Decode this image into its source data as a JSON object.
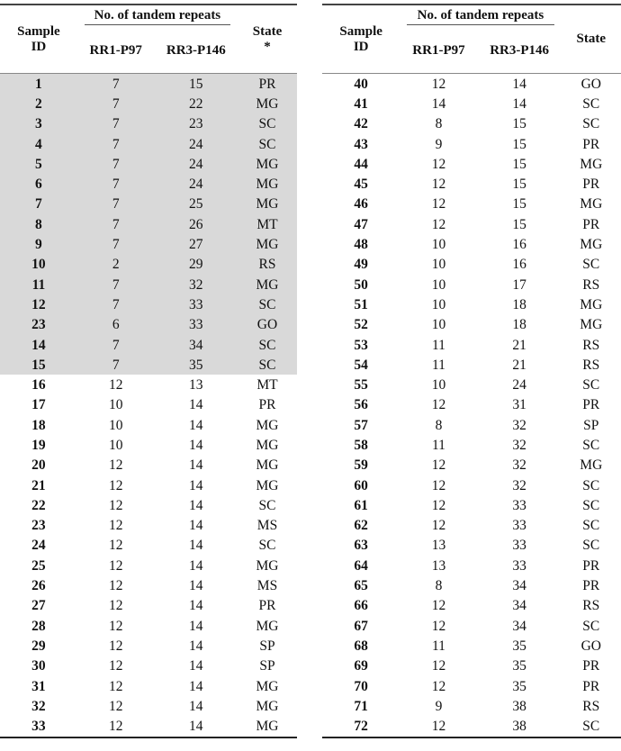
{
  "left_table": {
    "headers": {
      "sample_id": "Sample\nID",
      "sample_id_line1": "Sample",
      "sample_id_line2": "ID",
      "group": "No. of tandem repeats",
      "rr1": "RR1-P97",
      "rr3": "RR3-P146",
      "state_line1": "State",
      "state_line2": "*"
    },
    "rows": [
      {
        "id": "1",
        "rr1": "7",
        "rr3": "15",
        "state": "PR",
        "shaded": true
      },
      {
        "id": "2",
        "rr1": "7",
        "rr3": "22",
        "state": "MG",
        "shaded": true
      },
      {
        "id": "3",
        "rr1": "7",
        "rr3": "23",
        "state": "SC",
        "shaded": true
      },
      {
        "id": "4",
        "rr1": "7",
        "rr3": "24",
        "state": "SC",
        "shaded": true
      },
      {
        "id": "5",
        "rr1": "7",
        "rr3": "24",
        "state": "MG",
        "shaded": true
      },
      {
        "id": "6",
        "rr1": "7",
        "rr3": "24",
        "state": "MG",
        "shaded": true
      },
      {
        "id": "7",
        "rr1": "7",
        "rr3": "25",
        "state": "MG",
        "shaded": true
      },
      {
        "id": "8",
        "rr1": "7",
        "rr3": "26",
        "state": "MT",
        "shaded": true
      },
      {
        "id": "9",
        "rr1": "7",
        "rr3": "27",
        "state": "MG",
        "shaded": true
      },
      {
        "id": "10",
        "rr1": "2",
        "rr3": "29",
        "state": "RS",
        "shaded": true
      },
      {
        "id": "11",
        "rr1": "7",
        "rr3": "32",
        "state": "MG",
        "shaded": true
      },
      {
        "id": "12",
        "rr1": "7",
        "rr3": "33",
        "state": "SC",
        "shaded": true
      },
      {
        "id": "23",
        "rr1": "6",
        "rr3": "33",
        "state": "GO",
        "shaded": true
      },
      {
        "id": "14",
        "rr1": "7",
        "rr3": "34",
        "state": "SC",
        "shaded": true
      },
      {
        "id": "15",
        "rr1": "7",
        "rr3": "35",
        "state": "SC",
        "shaded": true
      },
      {
        "id": "16",
        "rr1": "12",
        "rr3": "13",
        "state": "MT",
        "shaded": false
      },
      {
        "id": "17",
        "rr1": "10",
        "rr3": "14",
        "state": "PR",
        "shaded": false
      },
      {
        "id": "18",
        "rr1": "10",
        "rr3": "14",
        "state": "MG",
        "shaded": false
      },
      {
        "id": "19",
        "rr1": "10",
        "rr3": "14",
        "state": "MG",
        "shaded": false
      },
      {
        "id": "20",
        "rr1": "12",
        "rr3": "14",
        "state": "MG",
        "shaded": false
      },
      {
        "id": "21",
        "rr1": "12",
        "rr3": "14",
        "state": "MG",
        "shaded": false
      },
      {
        "id": "22",
        "rr1": "12",
        "rr3": "14",
        "state": "SC",
        "shaded": false
      },
      {
        "id": "23",
        "rr1": "12",
        "rr3": "14",
        "state": "MS",
        "shaded": false
      },
      {
        "id": "24",
        "rr1": "12",
        "rr3": "14",
        "state": "SC",
        "shaded": false
      },
      {
        "id": "25",
        "rr1": "12",
        "rr3": "14",
        "state": "MG",
        "shaded": false
      },
      {
        "id": "26",
        "rr1": "12",
        "rr3": "14",
        "state": "MS",
        "shaded": false
      },
      {
        "id": "27",
        "rr1": "12",
        "rr3": "14",
        "state": "PR",
        "shaded": false
      },
      {
        "id": "28",
        "rr1": "12",
        "rr3": "14",
        "state": "MG",
        "shaded": false
      },
      {
        "id": "29",
        "rr1": "12",
        "rr3": "14",
        "state": "SP",
        "shaded": false
      },
      {
        "id": "30",
        "rr1": "12",
        "rr3": "14",
        "state": "SP",
        "shaded": false
      },
      {
        "id": "31",
        "rr1": "12",
        "rr3": "14",
        "state": "MG",
        "shaded": false
      },
      {
        "id": "32",
        "rr1": "12",
        "rr3": "14",
        "state": "MG",
        "shaded": false
      },
      {
        "id": "33",
        "rr1": "12",
        "rr3": "14",
        "state": "MG",
        "shaded": false
      }
    ]
  },
  "right_table": {
    "headers": {
      "sample_id_line1": "Sample",
      "sample_id_line2": "ID",
      "group": "No. of tandem repeats",
      "rr1": "RR1-P97",
      "rr3": "RR3-P146",
      "state_line1": "State",
      "state_line2": ""
    },
    "rows": [
      {
        "id": "40",
        "rr1": "12",
        "rr3": "14",
        "state": "GO"
      },
      {
        "id": "41",
        "rr1": "14",
        "rr3": "14",
        "state": "SC"
      },
      {
        "id": "42",
        "rr1": "8",
        "rr3": "15",
        "state": "SC"
      },
      {
        "id": "43",
        "rr1": "9",
        "rr3": "15",
        "state": "PR"
      },
      {
        "id": "44",
        "rr1": "12",
        "rr3": "15",
        "state": "MG"
      },
      {
        "id": "45",
        "rr1": "12",
        "rr3": "15",
        "state": "PR"
      },
      {
        "id": "46",
        "rr1": "12",
        "rr3": "15",
        "state": "MG"
      },
      {
        "id": "47",
        "rr1": "12",
        "rr3": "15",
        "state": "PR"
      },
      {
        "id": "48",
        "rr1": "10",
        "rr3": "16",
        "state": "MG"
      },
      {
        "id": "49",
        "rr1": "10",
        "rr3": "16",
        "state": "SC"
      },
      {
        "id": "50",
        "rr1": "10",
        "rr3": "17",
        "state": "RS"
      },
      {
        "id": "51",
        "rr1": "10",
        "rr3": "18",
        "state": "MG"
      },
      {
        "id": "52",
        "rr1": "10",
        "rr3": "18",
        "state": "MG"
      },
      {
        "id": "53",
        "rr1": "11",
        "rr3": "21",
        "state": "RS"
      },
      {
        "id": "54",
        "rr1": "11",
        "rr3": "21",
        "state": "RS"
      },
      {
        "id": "55",
        "rr1": "10",
        "rr3": "24",
        "state": "SC"
      },
      {
        "id": "56",
        "rr1": "12",
        "rr3": "31",
        "state": "PR"
      },
      {
        "id": "57",
        "rr1": "8",
        "rr3": "32",
        "state": "SP"
      },
      {
        "id": "58",
        "rr1": "11",
        "rr3": "32",
        "state": "SC"
      },
      {
        "id": "59",
        "rr1": "12",
        "rr3": "32",
        "state": "MG"
      },
      {
        "id": "60",
        "rr1": "12",
        "rr3": "32",
        "state": "SC"
      },
      {
        "id": "61",
        "rr1": "12",
        "rr3": "33",
        "state": "SC"
      },
      {
        "id": "62",
        "rr1": "12",
        "rr3": "33",
        "state": "SC"
      },
      {
        "id": "63",
        "rr1": "13",
        "rr3": "33",
        "state": "SC"
      },
      {
        "id": "64",
        "rr1": "13",
        "rr3": "33",
        "state": "PR"
      },
      {
        "id": "65",
        "rr1": "8",
        "rr3": "34",
        "state": "PR"
      },
      {
        "id": "66",
        "rr1": "12",
        "rr3": "34",
        "state": "RS"
      },
      {
        "id": "67",
        "rr1": "12",
        "rr3": "34",
        "state": "SC"
      },
      {
        "id": "68",
        "rr1": "11",
        "rr3": "35",
        "state": "GO"
      },
      {
        "id": "69",
        "rr1": "12",
        "rr3": "35",
        "state": "PR"
      },
      {
        "id": "70",
        "rr1": "12",
        "rr3": "35",
        "state": "PR"
      },
      {
        "id": "71",
        "rr1": "9",
        "rr3": "38",
        "state": "RS"
      },
      {
        "id": "72",
        "rr1": "12",
        "rr3": "38",
        "state": "SC"
      }
    ]
  },
  "colors": {
    "shade": "#d9d9d9",
    "rule": "#444444",
    "text": "#111111"
  }
}
